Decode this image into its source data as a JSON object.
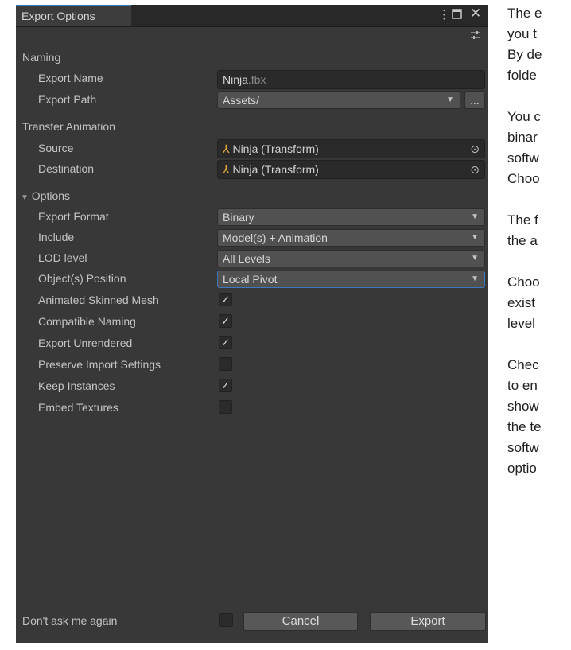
{
  "window": {
    "tab_title": "Export Options",
    "icons": [
      "kebab-menu-icon",
      "maximize-icon",
      "close-icon",
      "settings-sliders-icon"
    ]
  },
  "naming": {
    "section_label": "Naming",
    "export_name_label": "Export Name",
    "export_name_base": "Ninja",
    "export_name_ext": ".fbx",
    "export_path_label": "Export Path",
    "export_path_value": "Assets/",
    "browse_label": "..."
  },
  "transfer": {
    "section_label": "Transfer Animation",
    "source_label": "Source",
    "source_value": "Ninja (Transform)",
    "destination_label": "Destination",
    "destination_value": "Ninja (Transform)"
  },
  "options": {
    "section_label": "Options",
    "export_format_label": "Export Format",
    "export_format_value": "Binary",
    "include_label": "Include",
    "include_value": "Model(s) + Animation",
    "lod_label": "LOD level",
    "lod_value": "All Levels",
    "object_position_label": "Object(s) Position",
    "object_position_value": "Local Pivot",
    "checkboxes": [
      {
        "label": "Animated Skinned Mesh",
        "checked": true
      },
      {
        "label": "Compatible Naming",
        "checked": true
      },
      {
        "label": "Export Unrendered",
        "checked": true
      },
      {
        "label": "Preserve Import Settings",
        "checked": false
      },
      {
        "label": "Keep Instances",
        "checked": true
      },
      {
        "label": "Embed Textures",
        "checked": false
      }
    ]
  },
  "footer": {
    "dont_ask_label": "Don't ask me again",
    "dont_ask_checked": false,
    "cancel_label": "Cancel",
    "export_label": "Export"
  },
  "side_text": {
    "lines": [
      [
        "The e",
        "you t",
        "By de",
        "folde"
      ],
      [
        "You c",
        "binar",
        "softw",
        "Choo"
      ],
      [
        "The f",
        "the a"
      ],
      [
        "Choo",
        "exist",
        "level"
      ],
      [
        "Chec",
        "to en",
        "show",
        "the te",
        "softw",
        "optio"
      ]
    ]
  },
  "colors": {
    "panel_bg": "#383838",
    "accent": "#3a79bb",
    "field_bg": "#2a2a2a",
    "dropdown_bg": "#515151"
  }
}
